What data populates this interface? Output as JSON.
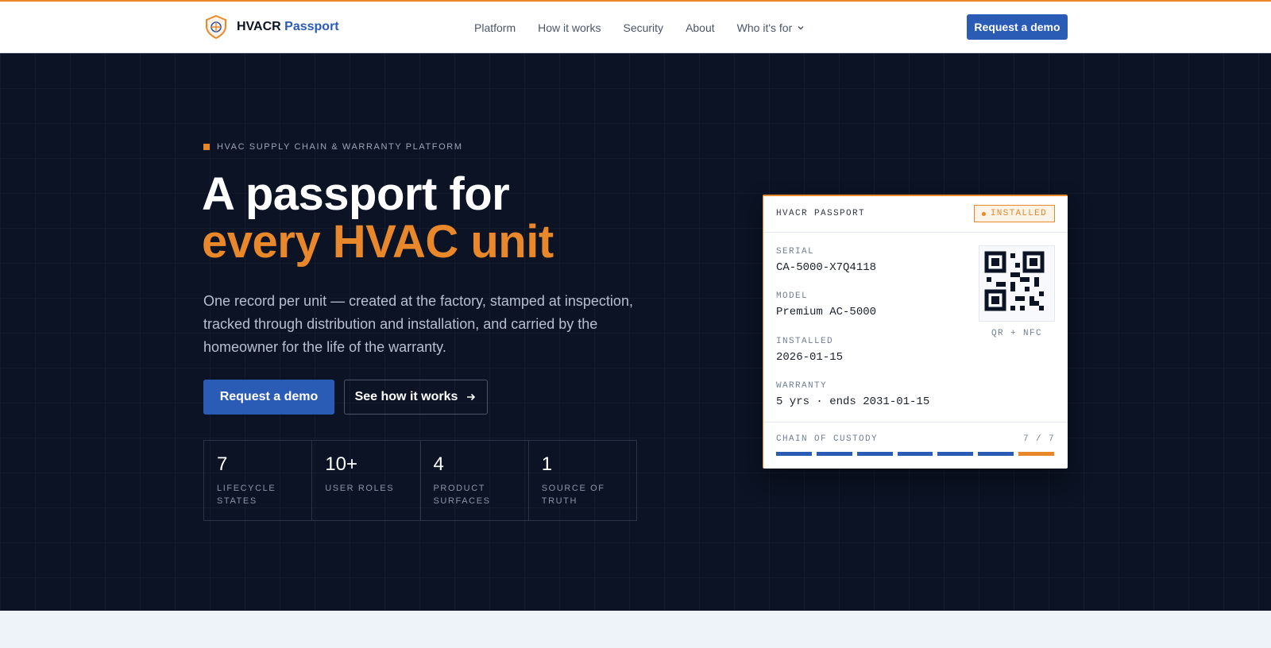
{
  "nav": {
    "brand_name": "HVACR",
    "brand_accent": "Passport",
    "links": [
      "Platform",
      "How it works",
      "Security",
      "About",
      "Who it's for"
    ],
    "cta": "Request a demo"
  },
  "hero": {
    "eyebrow": "HVAC SUPPLY CHAIN & WARRANTY PLATFORM",
    "title_line1": "A passport for",
    "title_line2": "every HVAC unit",
    "lead": "One record per unit — created at the factory, stamped at inspection, tracked through distribution and installation, and carried by the homeowner for the life of the warranty.",
    "primary_cta": "Request a demo",
    "secondary_cta": "See how it works",
    "stats": [
      {
        "value": "7",
        "label": "LIFECYCLE STATES"
      },
      {
        "value": "10+",
        "label": "USER ROLES"
      },
      {
        "value": "4",
        "label": "PRODUCT SURFACES"
      },
      {
        "value": "1",
        "label": "SOURCE OF TRUTH"
      }
    ]
  },
  "card": {
    "title": "HVACR PASSPORT",
    "status": "INSTALLED",
    "fields": [
      {
        "label": "SERIAL",
        "value": "CA-5000-X7Q4118"
      },
      {
        "label": "MODEL",
        "value": "Premium AC-5000"
      },
      {
        "label": "INSTALLED",
        "value": "2026-01-15"
      },
      {
        "label": "WARRANTY",
        "value": "5 yrs · ends 2031-01-15"
      }
    ],
    "qr_caption": "QR + NFC",
    "custody_label": "CHAIN OF CUSTODY",
    "custody_count": "7 / 7",
    "custody_completed": 7,
    "custody_total": 7
  },
  "colors": {
    "accent": "#e8882a",
    "brand_blue": "#2b5cb5",
    "hero_bg": "#0b1324"
  },
  "icons": {
    "brand": "shield-logo-icon",
    "dropdown": "chevron-down-icon",
    "arrow": "arrow-right-icon",
    "qr": "qr-code-icon"
  }
}
